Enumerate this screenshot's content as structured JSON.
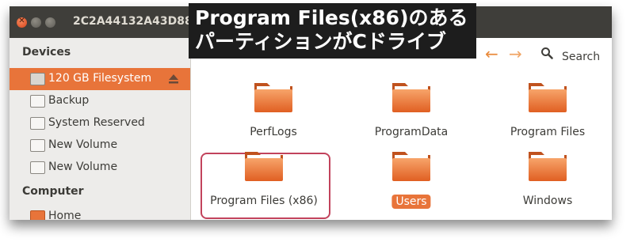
{
  "window": {
    "title": "2C2A44132A43D88"
  },
  "caption": {
    "line1": "Program Files(x86)のある",
    "line2": "パーティションがCドライブ"
  },
  "toolbar": {
    "search_label": "Search"
  },
  "sidebar": {
    "devices_header": "Devices",
    "computer_header": "Computer",
    "items": [
      {
        "label": "120 GB Filesystem",
        "selected": true,
        "icon": "drive-icon"
      },
      {
        "label": "Backup",
        "icon": "drive-icon"
      },
      {
        "label": "System Reserved",
        "icon": "drive-icon"
      },
      {
        "label": "New Volume",
        "icon": "drive-icon"
      },
      {
        "label": "New Volume",
        "icon": "usb-drive-icon"
      }
    ],
    "home_label": "Home"
  },
  "folders": [
    {
      "name": "PerfLogs"
    },
    {
      "name": "ProgramData"
    },
    {
      "name": "Program Files"
    },
    {
      "name": "Program Files (x86)",
      "highlighted": true
    },
    {
      "name": "Users",
      "selected": true
    },
    {
      "name": "Windows"
    }
  ],
  "colors": {
    "accent": "#e8743a",
    "titlebar": "#3f3e3a",
    "highlight_border": "#c2435c"
  }
}
